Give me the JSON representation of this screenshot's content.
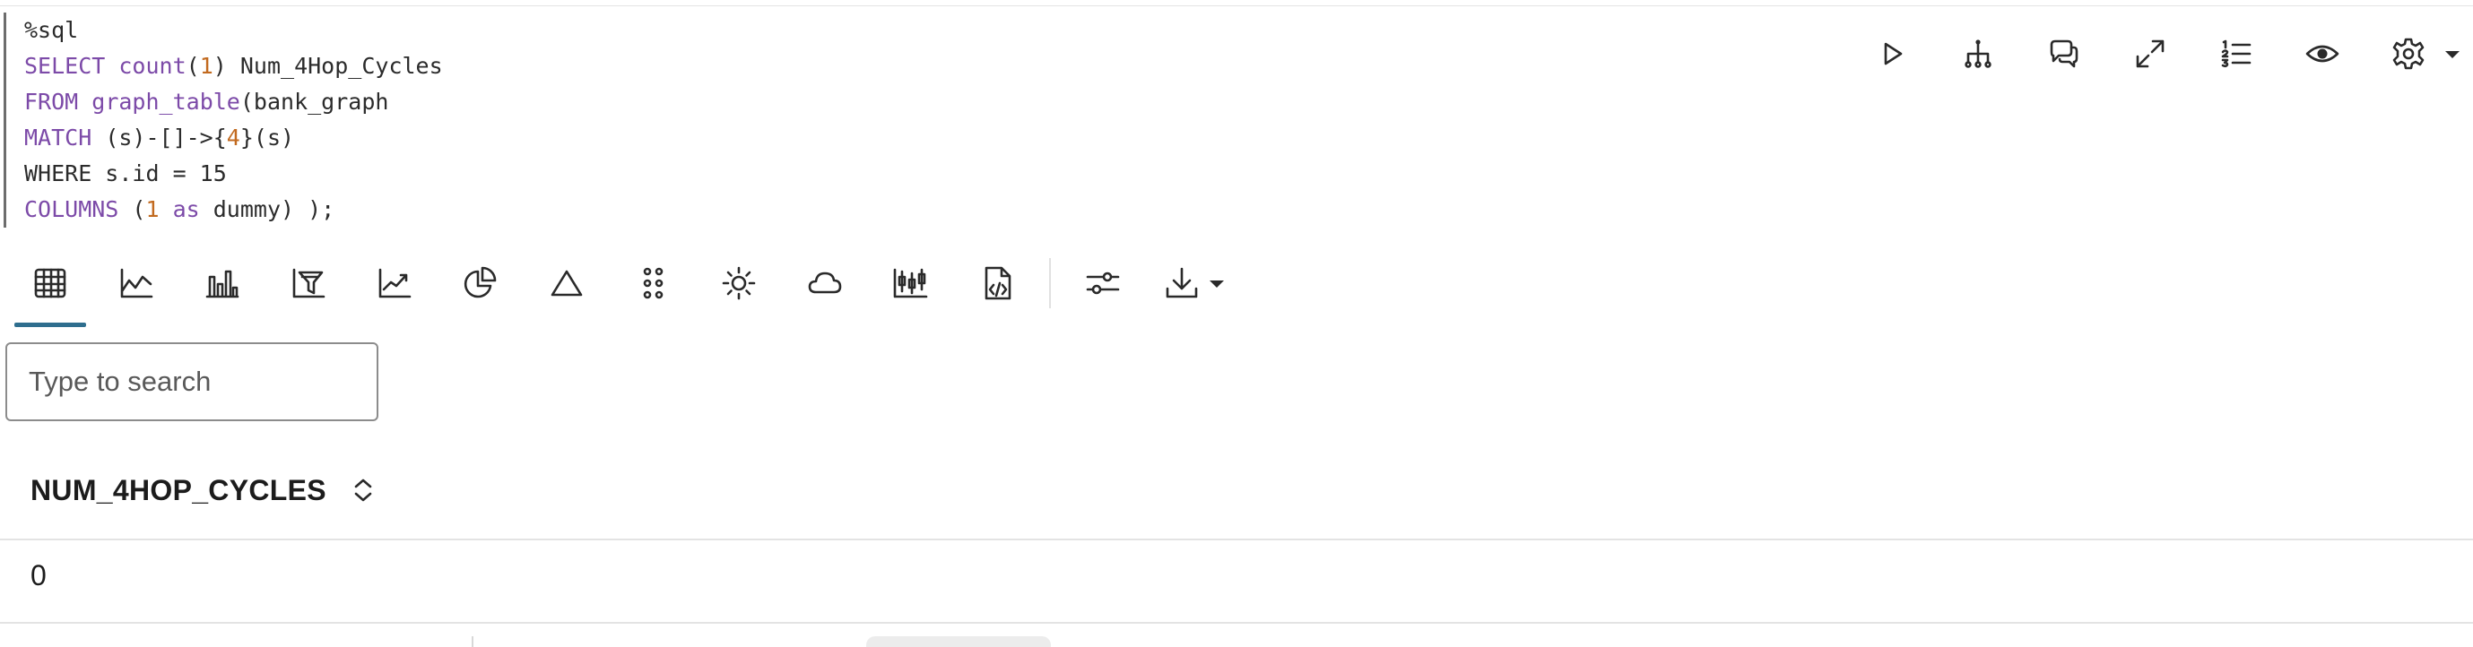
{
  "editor": {
    "line1": "%sql",
    "line2": {
      "kw1": "SELECT",
      "fn": "count",
      "num": "1",
      "rest": " Num_4Hop_Cycles"
    },
    "line3": {
      "kw1": "FROM",
      "fn": "graph_table",
      "rest": "(bank_graph"
    },
    "line4": {
      "kw1": "MATCH",
      "pre": " (s)-[]->{",
      "num": "4",
      "post": "}(s)"
    },
    "line5": "WHERE s.id = 15",
    "line6": {
      "kw1": "COLUMNS",
      "pre": " (",
      "num": "1",
      "kw2": "as",
      "post": " dummy) );"
    }
  },
  "paragraph_toolbar": [
    "run-icon",
    "hierarchy-icon",
    "comment-icon",
    "expand-icon",
    "numbered-list-icon",
    "eye-icon",
    "gear-icon",
    "caret-down-icon"
  ],
  "visualization_toolbar": [
    "table-icon",
    "area-chart-icon",
    "bar-chart-icon",
    "funnel-icon",
    "line-chart-icon",
    "pie-chart-icon",
    "triangle-icon",
    "dots-grid-icon",
    "sun-icon",
    "cloud-icon",
    "candlestick-icon",
    "code-file-icon",
    "sliders-icon",
    "download-icon",
    "caret-down-icon"
  ],
  "search": {
    "placeholder": "Type to search"
  },
  "table": {
    "columns": [
      "NUM_4HOP_CYCLES"
    ],
    "rows": [
      [
        "0"
      ]
    ]
  },
  "colors": {
    "accent": "#2e6e8e",
    "keyword": "#7c4aa8",
    "number": "#c26a1f"
  }
}
